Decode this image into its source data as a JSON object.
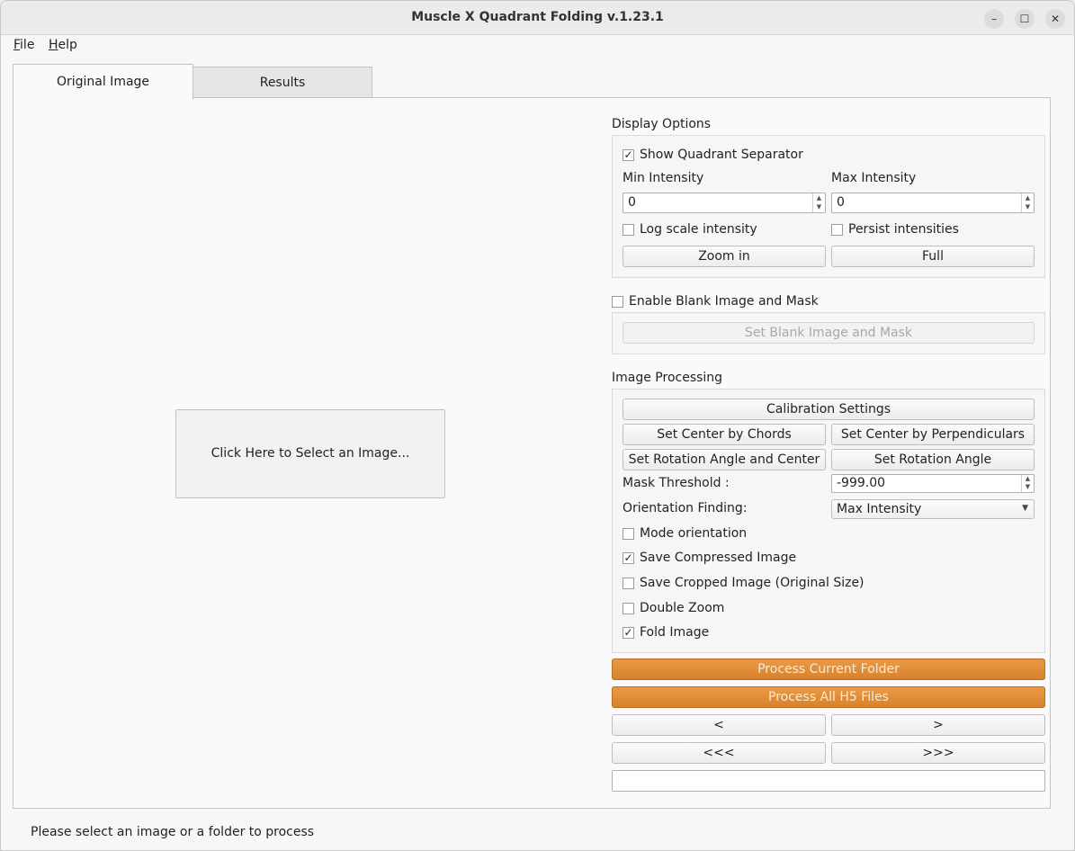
{
  "window": {
    "title": "Muscle X Quadrant Folding v.1.23.1",
    "controls": {
      "minimize": "–",
      "maximize": "☐",
      "close": "✕"
    }
  },
  "menu": {
    "file": {
      "accel": "F",
      "rest": "ile"
    },
    "help": {
      "accel": "H",
      "rest": "elp"
    }
  },
  "tabs": [
    {
      "label": "Original Image",
      "active": true
    },
    {
      "label": "Results",
      "active": false
    }
  ],
  "image_area": {
    "select_button": "Click Here to Select an Image..."
  },
  "display_options": {
    "title": "Display Options",
    "show_quadrant_separator": {
      "label": "Show Quadrant Separator",
      "checked": true
    },
    "min_intensity": {
      "label": "Min Intensity",
      "value": "0"
    },
    "max_intensity": {
      "label": "Max Intensity",
      "value": "0"
    },
    "log_scale": {
      "label": "Log scale intensity",
      "checked": false
    },
    "persist_intensities": {
      "label": "Persist intensities",
      "checked": false
    },
    "zoom_in": "Zoom in",
    "full": "Full"
  },
  "blank_mask": {
    "enable": {
      "label": "Enable Blank Image and Mask",
      "checked": false
    },
    "set_button": "Set Blank Image and Mask"
  },
  "image_processing": {
    "title": "Image Processing",
    "calibration": "Calibration Settings",
    "center_chords": "Set Center by Chords",
    "center_perpendiculars": "Set Center by Perpendiculars",
    "rotation_angle_center": "Set Rotation Angle and Center",
    "rotation_angle": "Set Rotation Angle",
    "mask_threshold": {
      "label": "Mask Threshold :",
      "value": "-999.00"
    },
    "orientation_finding": {
      "label": "Orientation Finding:",
      "value": "Max Intensity"
    },
    "mode_orientation": {
      "label": "Mode orientation",
      "checked": false
    },
    "save_compressed": {
      "label": "Save Compressed Image",
      "checked": true
    },
    "save_cropped": {
      "label": "Save Cropped Image (Original Size)",
      "checked": false
    },
    "double_zoom": {
      "label": "Double Zoom",
      "checked": false
    },
    "fold_image": {
      "label": "Fold Image",
      "checked": true
    }
  },
  "actions": {
    "process_folder": "Process Current Folder",
    "process_h5": "Process All H5 Files",
    "prev": "<",
    "next": ">",
    "prev_fast": "<<<",
    "next_fast": ">>>",
    "filename": ""
  },
  "status": {
    "message": "Please select an image or a folder to process"
  },
  "colors": {
    "accent_orange": "#d9822b"
  }
}
